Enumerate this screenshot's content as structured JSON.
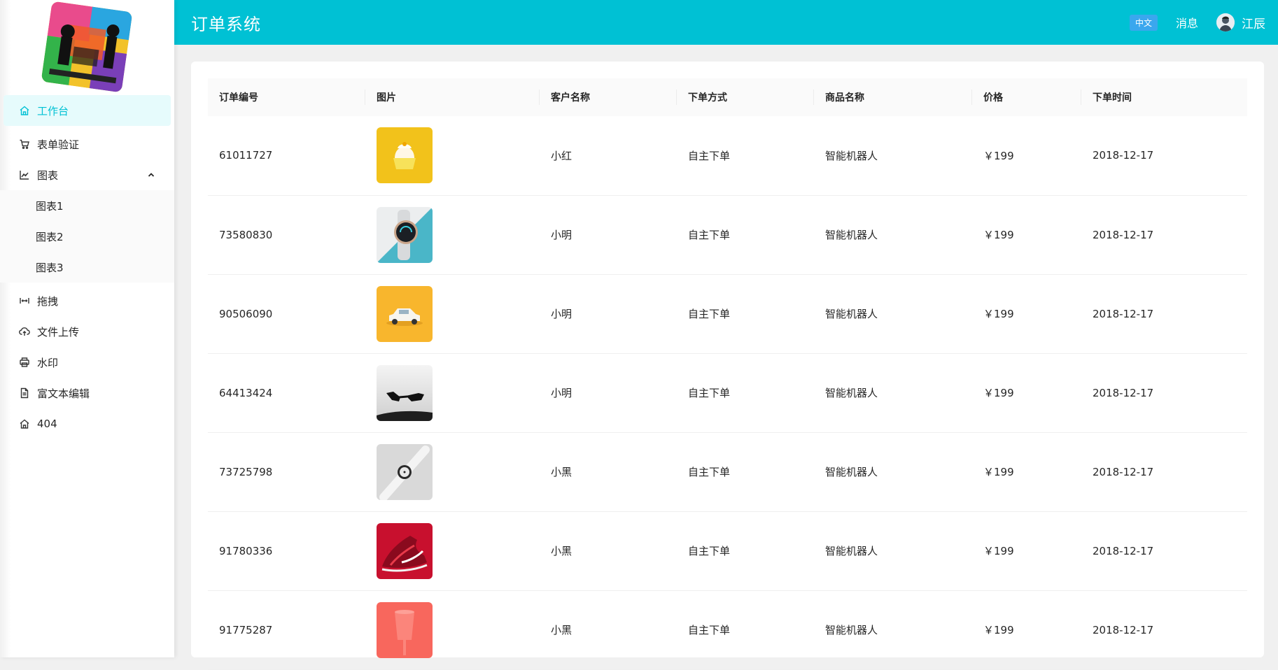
{
  "header": {
    "title": "订单系统",
    "lang_badge": "中文",
    "messages": "消息",
    "username": "江辰"
  },
  "sidebar": {
    "items": [
      {
        "label": "工作台",
        "icon": "home-icon",
        "active": true
      },
      {
        "label": "表单验证",
        "icon": "cart-icon"
      },
      {
        "label": "图表",
        "icon": "chart-icon",
        "expanded": true,
        "children": [
          {
            "label": "图表1"
          },
          {
            "label": "图表2"
          },
          {
            "label": "图表3"
          }
        ]
      },
      {
        "label": "拖拽",
        "icon": "drag-icon"
      },
      {
        "label": "文件上传",
        "icon": "cloud-upload-icon"
      },
      {
        "label": "水印",
        "icon": "printer-icon"
      },
      {
        "label": "富文本编辑",
        "icon": "document-icon"
      },
      {
        "label": "404",
        "icon": "home-icon"
      }
    ]
  },
  "table": {
    "columns": [
      "订单编号",
      "图片",
      "客户名称",
      "下单方式",
      "商品名称",
      "价格",
      "下单时间"
    ],
    "rows": [
      {
        "order_no": "61011727",
        "image": "cupcake-image",
        "customer": "小红",
        "method": "自主下单",
        "product": "智能机器人",
        "price": "￥199",
        "date": "2018-12-17"
      },
      {
        "order_no": "73580830",
        "image": "smartwatch-image",
        "customer": "小明",
        "method": "自主下单",
        "product": "智能机器人",
        "price": "￥199",
        "date": "2018-12-17"
      },
      {
        "order_no": "90506090",
        "image": "toy-car-image",
        "customer": "小明",
        "method": "自主下单",
        "product": "智能机器人",
        "price": "￥199",
        "date": "2018-12-17"
      },
      {
        "order_no": "64413424",
        "image": "sunglasses-image",
        "customer": "小明",
        "method": "自主下单",
        "product": "智能机器人",
        "price": "￥199",
        "date": "2018-12-17"
      },
      {
        "order_no": "73725798",
        "image": "wristwatch-image",
        "customer": "小黑",
        "method": "自主下单",
        "product": "智能机器人",
        "price": "￥199",
        "date": "2018-12-17"
      },
      {
        "order_no": "91780336",
        "image": "sneaker-image",
        "customer": "小黑",
        "method": "自主下单",
        "product": "智能机器人",
        "price": "￥199",
        "date": "2018-12-17"
      },
      {
        "order_no": "91775287",
        "image": "cup-image",
        "customer": "小黑",
        "method": "自主下单",
        "product": "智能机器人",
        "price": "￥199",
        "date": "2018-12-17"
      }
    ]
  },
  "colors": {
    "accent": "#00c1d4",
    "active_bg": "#e6fbfc",
    "badge": "#3aa7ee"
  }
}
